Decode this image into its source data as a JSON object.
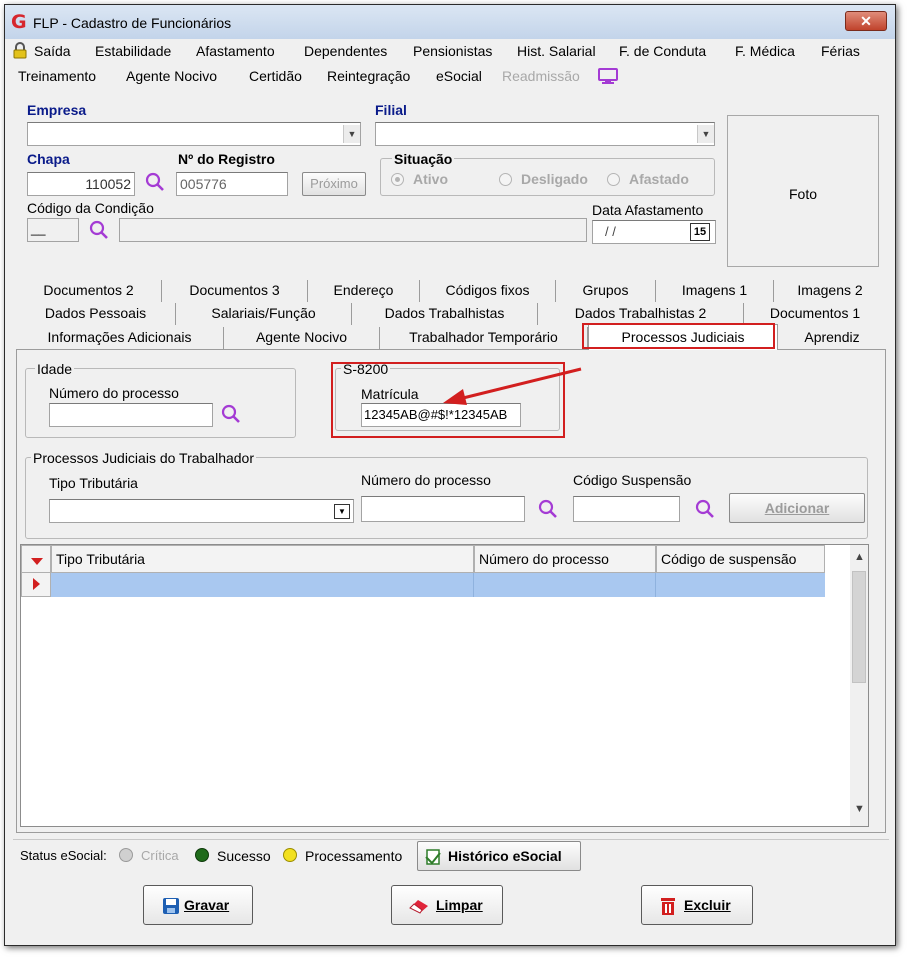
{
  "window": {
    "title": "FLP - Cadastro de Funcionários",
    "close_glyph": "✕",
    "logo": "G"
  },
  "menu": {
    "row1": [
      "Saída",
      "Estabilidade",
      "Afastamento",
      "Dependentes",
      "Pensionistas",
      "Hist. Salarial",
      "F. de Conduta",
      "F. Médica",
      "Férias"
    ],
    "row2": [
      "Treinamento",
      "Agente Nocivo",
      "Certidão",
      "Reintegração",
      "eSocial",
      "Readmissão"
    ]
  },
  "form": {
    "empresa_label": "Empresa",
    "filial_label": "Filial",
    "chapa_label": "Chapa",
    "chapa_value": "110052",
    "registro_label": "Nº do Registro",
    "registro_value": "005776",
    "proximo_label": "Próximo",
    "situacao_label": "Situação",
    "situacao_options": [
      "Ativo",
      "Desligado",
      "Afastado"
    ],
    "codigo_condicao_label": "Código da Condição",
    "codigo_condicao_value": "__",
    "data_afastamento_label": "Data Afastamento",
    "data_afastamento_value": "/ /",
    "calendar_glyph": "15",
    "foto_label": "Foto"
  },
  "tabs": {
    "row1": [
      "Documentos 2",
      "Documentos 3",
      "Endereço",
      "Códigos fixos",
      "Grupos",
      "Imagens 1",
      "Imagens 2"
    ],
    "row2": [
      "Dados Pessoais",
      "Salariais/Função",
      "Dados Trabalhistas",
      "Dados Trabalhistas 2",
      "Documentos 1"
    ],
    "row3": [
      "Informações Adicionais",
      "Agente Nocivo",
      "Trabalhador Temporário",
      "Processos Judiciais",
      "Aprendiz"
    ],
    "active": "Processos Judiciais"
  },
  "idade": {
    "group_title": "Idade",
    "numero_label": "Número do processo"
  },
  "s8200": {
    "group_title": "S-8200",
    "matricula_label": "Matrícula",
    "matricula_value": "12345AB@#$!*12345AB"
  },
  "processos": {
    "group_title": "Processos Judiciais do Trabalhador",
    "tipo_label": "Tipo Tributária",
    "numero_label": "Número do processo",
    "codigo_label": "Código Suspensão",
    "adicionar_label": "Adicionar"
  },
  "grid": {
    "columns": [
      "Tipo Tributária",
      "Número do processo",
      "Código de suspensão"
    ]
  },
  "status": {
    "label": "Status eSocial:",
    "items": [
      {
        "label": "Crítica",
        "color": "#b9b9b9"
      },
      {
        "label": "Sucesso",
        "color": "#1f6b1a"
      },
      {
        "label": "Processamento",
        "color": "#f2e01e"
      }
    ],
    "historico_label": "Histórico eSocial"
  },
  "actions": {
    "gravar": "Gravar",
    "limpar": "Limpar",
    "excluir": "Excluir"
  },
  "colors": {
    "accent_blue": "#0a1b8a",
    "highlight_red": "#d21f1f",
    "selection_blue": "#a9c8f0",
    "icon_purple": "#a43bd4"
  }
}
